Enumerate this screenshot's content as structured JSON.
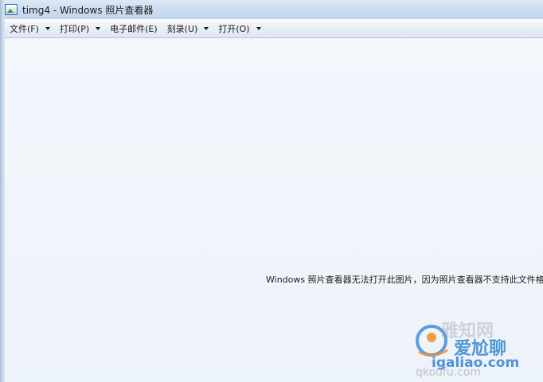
{
  "window": {
    "title": "timg4 - Windows 照片查看器",
    "icon": "photo-viewer-icon"
  },
  "menubar": {
    "items": [
      {
        "label": "文件(F)",
        "has_dropdown": true
      },
      {
        "label": "打印(P)",
        "has_dropdown": true
      },
      {
        "label": "电子邮件(E)",
        "has_dropdown": false
      },
      {
        "label": "刻录(U)",
        "has_dropdown": true
      },
      {
        "label": "打开(O)",
        "has_dropdown": true
      }
    ]
  },
  "viewer": {
    "error_message": "Windows 照片查看器无法打开此图片，因为照片查看器不支持此文件格式，"
  },
  "watermark": {
    "line1": "雅知网",
    "line2": "爱尬聊",
    "line3": "igaliao.com",
    "line4": "qkoufu.com"
  },
  "colors": {
    "titlebar": "#cbdbee",
    "menubar": "#e9eff8",
    "viewer_background": "#f1f5fb"
  }
}
